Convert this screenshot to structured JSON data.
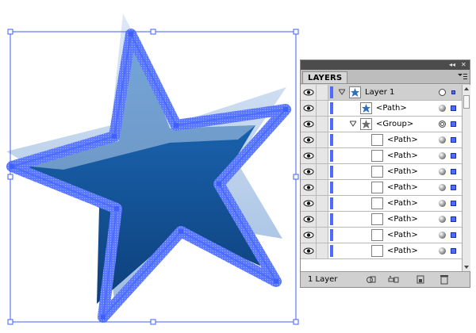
{
  "panel": {
    "tab_label": "LAYERS",
    "footer_count": "1 Layer",
    "layers": [
      {
        "name": "Layer 1",
        "kind": "layer",
        "target": "ring",
        "selected": true
      },
      {
        "name": "<Path>",
        "kind": "path-star",
        "target": "ball"
      },
      {
        "name": "<Group>",
        "kind": "group",
        "target": "double-ring"
      },
      {
        "name": "<Path>",
        "kind": "path"
      },
      {
        "name": "<Path>",
        "kind": "path"
      },
      {
        "name": "<Path>",
        "kind": "path"
      },
      {
        "name": "<Path>",
        "kind": "path"
      },
      {
        "name": "<Path>",
        "kind": "path"
      },
      {
        "name": "<Path>",
        "kind": "path"
      },
      {
        "name": "<Path>",
        "kind": "path"
      },
      {
        "name": "<Path>",
        "kind": "path"
      }
    ]
  },
  "colors": {
    "selection": "#4f6bff",
    "star_dark": "#1a5fa8",
    "star_light": "#c9daef"
  }
}
